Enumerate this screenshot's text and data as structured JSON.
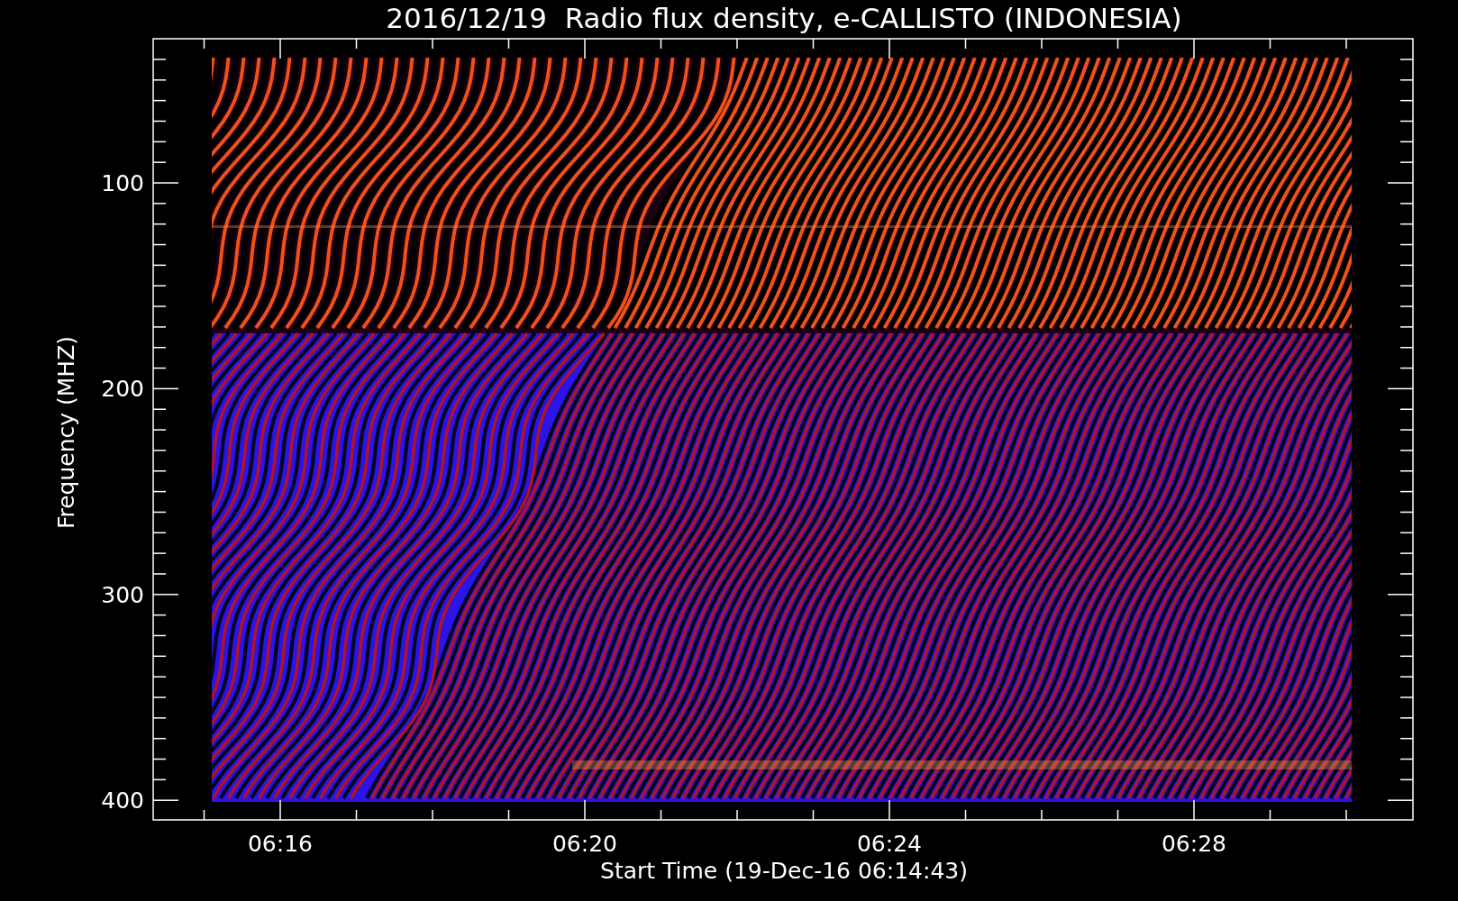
{
  "title": "2016/12/19  Radio flux density, e-CALLISTO (INDONESIA)",
  "y_axis": {
    "label": "Frequency (MHZ)",
    "ticks": [
      "100",
      "200",
      "300",
      "400"
    ]
  },
  "x_axis": {
    "label": "Start Time (19-Dec-16 06:14:43)",
    "ticks": [
      "06:16",
      "06:20",
      "06:24",
      "06:28"
    ]
  }
}
